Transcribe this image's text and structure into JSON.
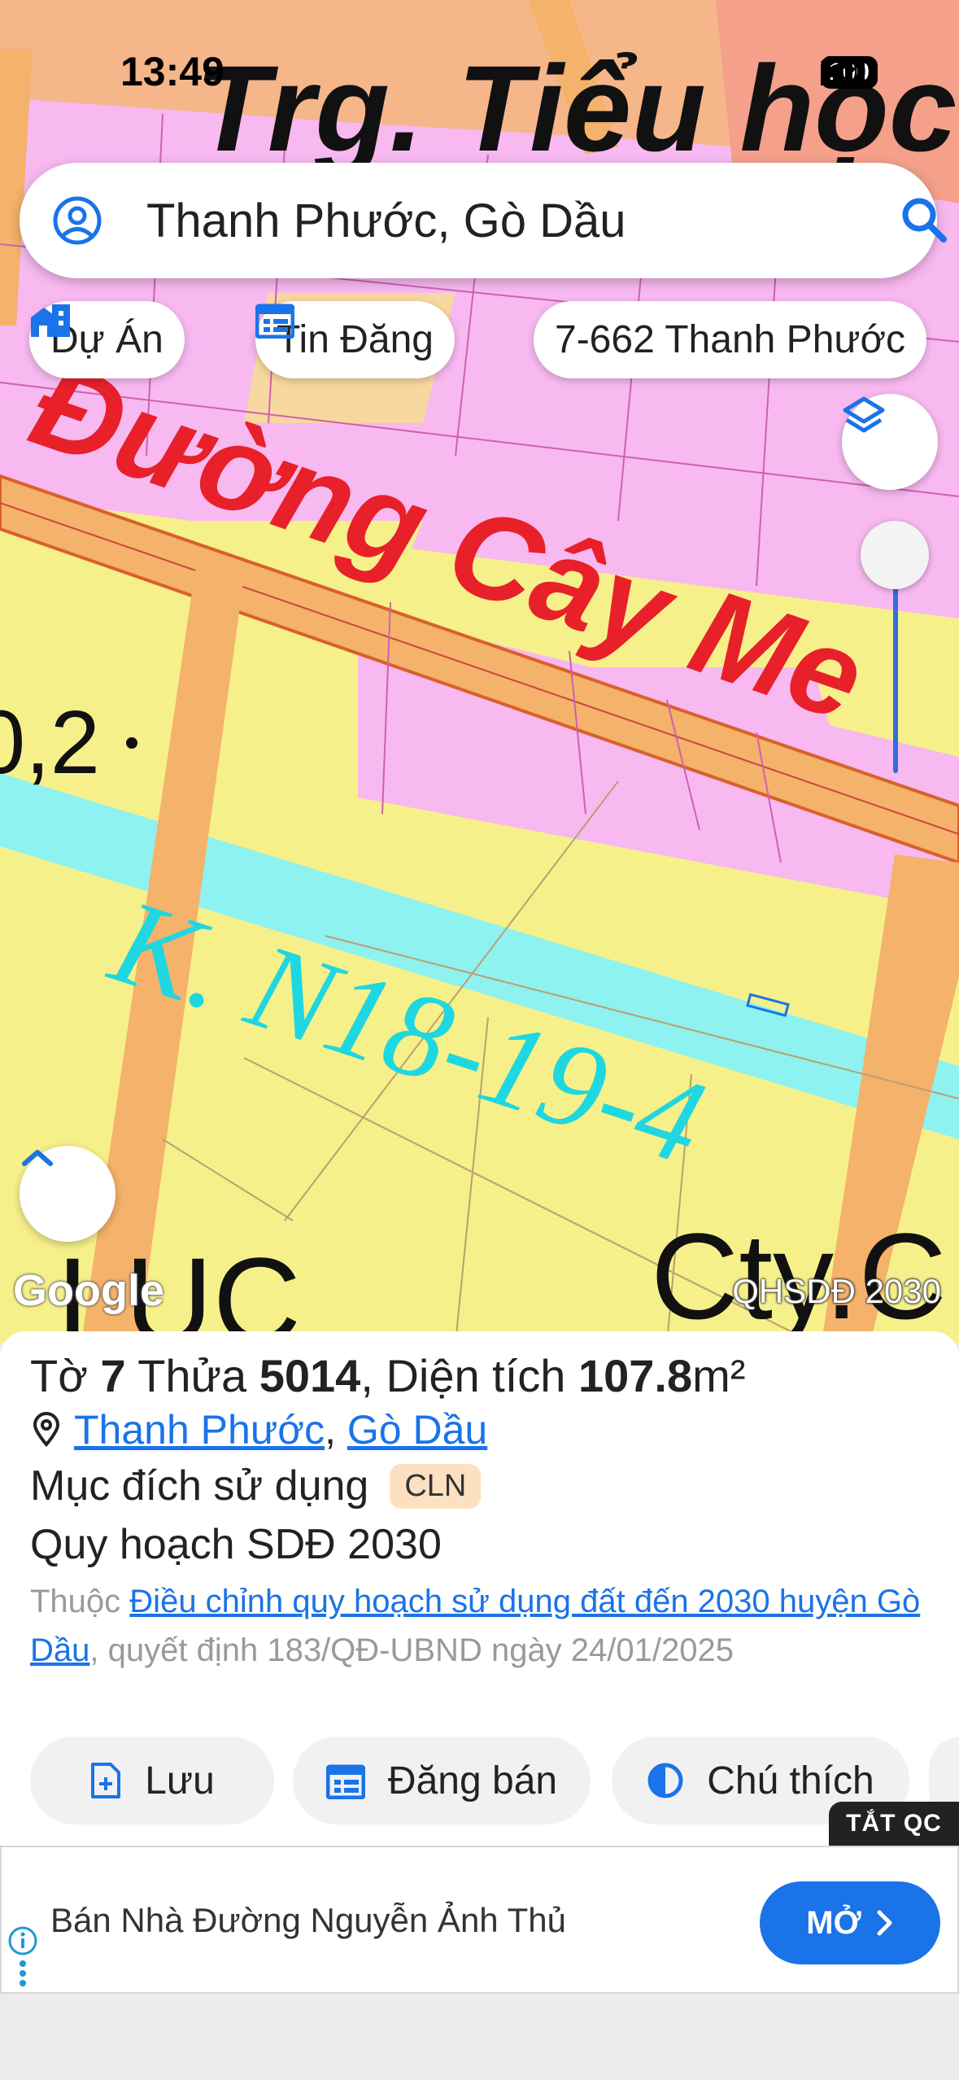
{
  "status_bar": {
    "time": "13:49",
    "battery": "100"
  },
  "search": {
    "query": "Thanh Phước, Gò Dầu"
  },
  "chips": [
    {
      "label": "Dự Án",
      "icon": "building-icon"
    },
    {
      "label": "Tin Đăng",
      "icon": "calendar-icon"
    },
    {
      "label": "7-662 Thanh Phước"
    }
  ],
  "map": {
    "labels": {
      "school": "Trg. Tiểu học",
      "road": "Đường Cây Me",
      "canal": "K. N18-19-4",
      "luc": "LUC",
      "cty": "Cty.C",
      "num": "0,2"
    },
    "google": "Google",
    "layer_label": "QHSDĐ 2030",
    "colors": {
      "pink": "#f7b9f0",
      "yellow": "#f6f08a",
      "orange": "#f4b26a",
      "cyan": "#8ef2f0",
      "road_text": "#e8202a",
      "canal_text": "#1fd7e0"
    }
  },
  "parcel": {
    "sheet_prefix": "Tờ",
    "sheet_no": "7",
    "plot_prefix": "Thửa",
    "plot_no": "5014",
    "area_prefix": ", Diện tích",
    "area_value": "107.8",
    "area_unit": "m²",
    "ward": "Thanh Phước",
    "district": "Gò Dầu",
    "purpose_label": "Mục đích sử dụng",
    "purpose_code": "CLN",
    "plan_label": "Quy hoạch SDĐ 2030",
    "source_prefix": "Thuộc",
    "source_link": "Điều chỉnh quy hoạch sử dụng đất đến 2030 huyện Gò Dầu",
    "source_suffix": ", quyết định 183/QĐ-UBND ngày 24/01/2025"
  },
  "actions": [
    {
      "label": "Lưu"
    },
    {
      "label": "Đăng bán"
    },
    {
      "label": "Chú thích"
    }
  ],
  "ad": {
    "off_label": "TẮT QC",
    "text": "Bán Nhà Đường Nguyễn Ảnh Thủ",
    "open_label": "MỞ"
  }
}
